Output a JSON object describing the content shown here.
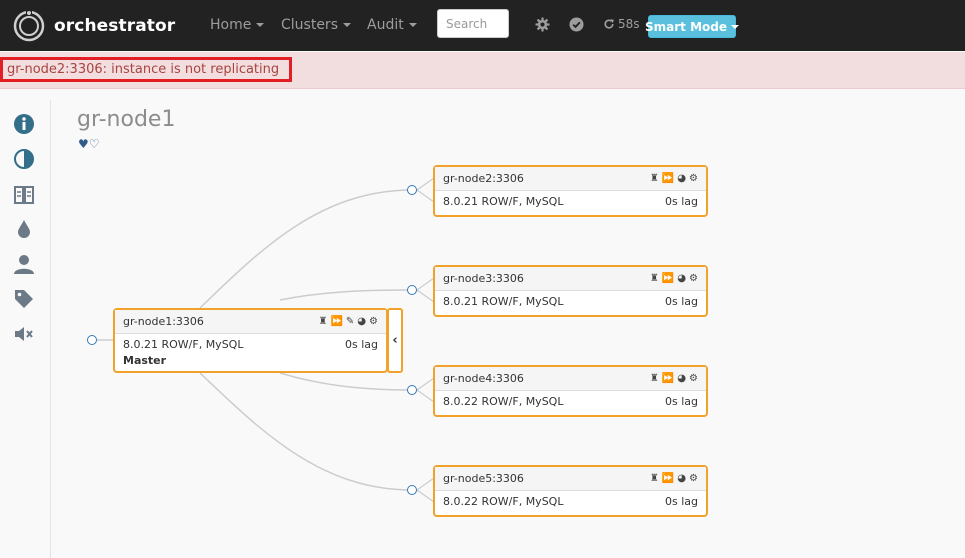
{
  "navbar": {
    "brand": "orchestrator",
    "menu": [
      {
        "label": "Home"
      },
      {
        "label": "Clusters"
      },
      {
        "label": "Audit"
      }
    ],
    "search_placeholder": "Search",
    "refresh_timer": "58s",
    "mode_button": "Smart Mode"
  },
  "alert": {
    "message": "gr-node2:3306: instance is not replicating"
  },
  "sidebar": {
    "icons": [
      "info-icon",
      "contrast-icon",
      "compare-icon",
      "drop-icon",
      "user-icon",
      "tag-icon",
      "mute-icon"
    ]
  },
  "cluster": {
    "title": "gr-node1",
    "hearts": "♥♡"
  },
  "master": {
    "name": "gr-node1:3306",
    "version": "8.0.21 ROW/F, MySQL",
    "lag": "0s lag",
    "role": "Master"
  },
  "replicas": [
    {
      "name": "gr-node2:3306",
      "version": "8.0.21 ROW/F, MySQL",
      "lag": "0s lag"
    },
    {
      "name": "gr-node3:3306",
      "version": "8.0.21 ROW/F, MySQL",
      "lag": "0s lag"
    },
    {
      "name": "gr-node4:3306",
      "version": "8.0.22 ROW/F, MySQL",
      "lag": "0s lag"
    },
    {
      "name": "gr-node5:3306",
      "version": "8.0.22 ROW/F, MySQL",
      "lag": "0s lag"
    }
  ],
  "colors": {
    "node_border": "#f0a22b",
    "alert_bg": "#f2dede",
    "alert_border": "#e31f26",
    "mode_button": "#5bc0de",
    "navbar": "#222222"
  }
}
